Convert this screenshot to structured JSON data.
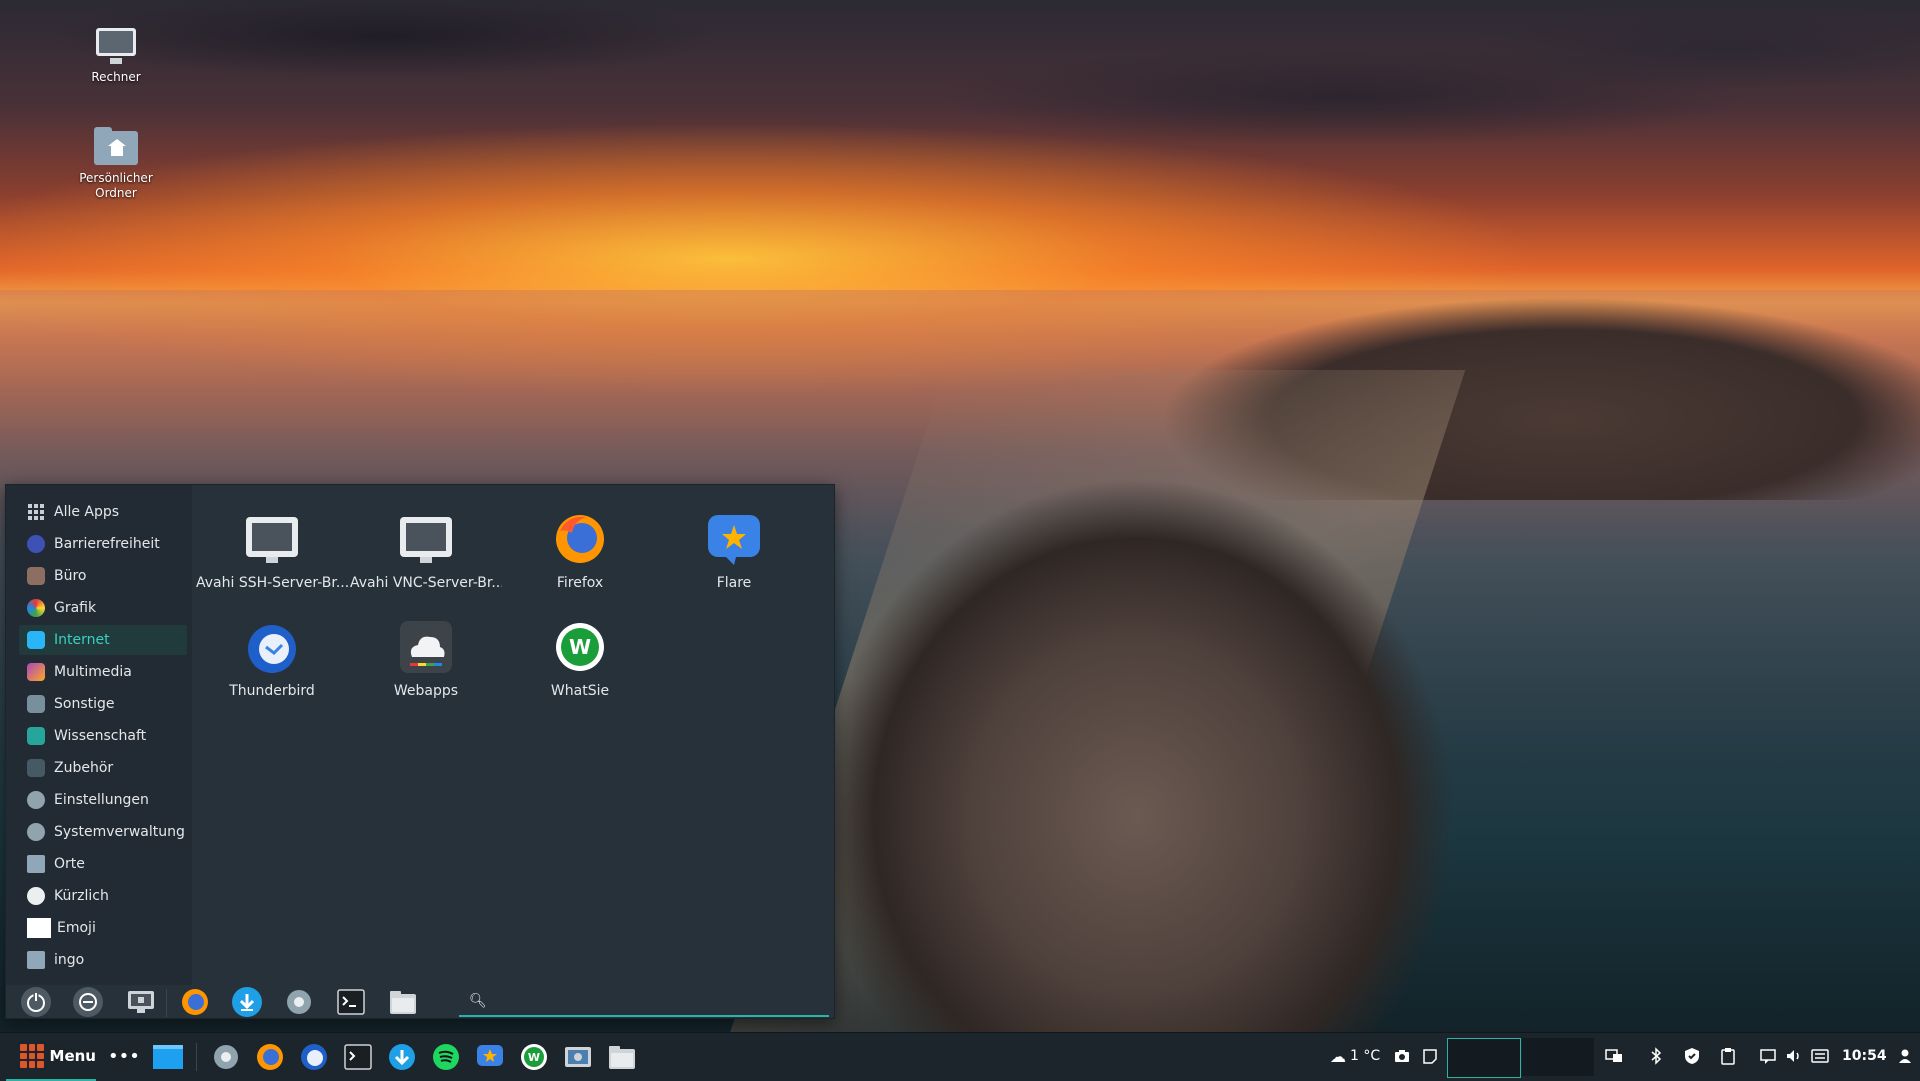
{
  "desktop": {
    "icons": [
      {
        "label": "Rechner",
        "icon": "computer-icon"
      },
      {
        "label": "Persönlicher Ordner",
        "icon": "home-folder-icon"
      }
    ]
  },
  "menu": {
    "categories": [
      {
        "label": "Alle Apps",
        "icon": "grid-icon"
      },
      {
        "label": "Barrierefreiheit",
        "icon": "accessibility-icon"
      },
      {
        "label": "Büro",
        "icon": "office-icon"
      },
      {
        "label": "Grafik",
        "icon": "graphics-icon"
      },
      {
        "label": "Internet",
        "icon": "internet-icon",
        "active": true
      },
      {
        "label": "Multimedia",
        "icon": "multimedia-icon"
      },
      {
        "label": "Sonstige",
        "icon": "other-icon"
      },
      {
        "label": "Wissenschaft",
        "icon": "science-icon"
      },
      {
        "label": "Zubehör",
        "icon": "accessories-icon"
      },
      {
        "label": "Einstellungen",
        "icon": "settings-icon"
      },
      {
        "label": "Systemverwaltung",
        "icon": "system-icon"
      },
      {
        "label": "Orte",
        "icon": "places-icon"
      },
      {
        "label": "Kürzlich",
        "icon": "recent-icon"
      },
      {
        "label": "Emoji",
        "icon": "emoji-icon"
      },
      {
        "label": "ingo",
        "icon": "user-folder-icon"
      }
    ],
    "apps": [
      {
        "label": "Avahi SSH-Server-Br...",
        "icon": "monitor-icon"
      },
      {
        "label": "Avahi VNC-Server-Br...",
        "icon": "monitor-icon"
      },
      {
        "label": "Firefox",
        "icon": "firefox-icon"
      },
      {
        "label": "Flare",
        "icon": "flare-icon"
      },
      {
        "label": "Thunderbird",
        "icon": "thunderbird-icon"
      },
      {
        "label": "Webapps",
        "icon": "webapps-icon"
      },
      {
        "label": "WhatSie",
        "icon": "whatsie-icon"
      }
    ],
    "bottom_buttons": [
      "power-icon",
      "logout-icon",
      "lock-screen-icon",
      "firefox-icon",
      "download-icon",
      "settings-icon",
      "terminal-icon",
      "file-manager-icon"
    ],
    "search": {
      "placeholder": "",
      "value": ""
    }
  },
  "taskbar": {
    "menu_label": "Menu",
    "launchers": [
      "show-desktop-icon",
      "settings-icon",
      "firefox-icon",
      "thunderbird-icon",
      "terminal-icon",
      "download-icon",
      "spotify-icon",
      "flare-icon",
      "whatsie-icon",
      "screenshot-icon",
      "file-manager-icon"
    ],
    "weather": "1 °C",
    "clock": "10:54",
    "accent": "#2ab3a6"
  }
}
